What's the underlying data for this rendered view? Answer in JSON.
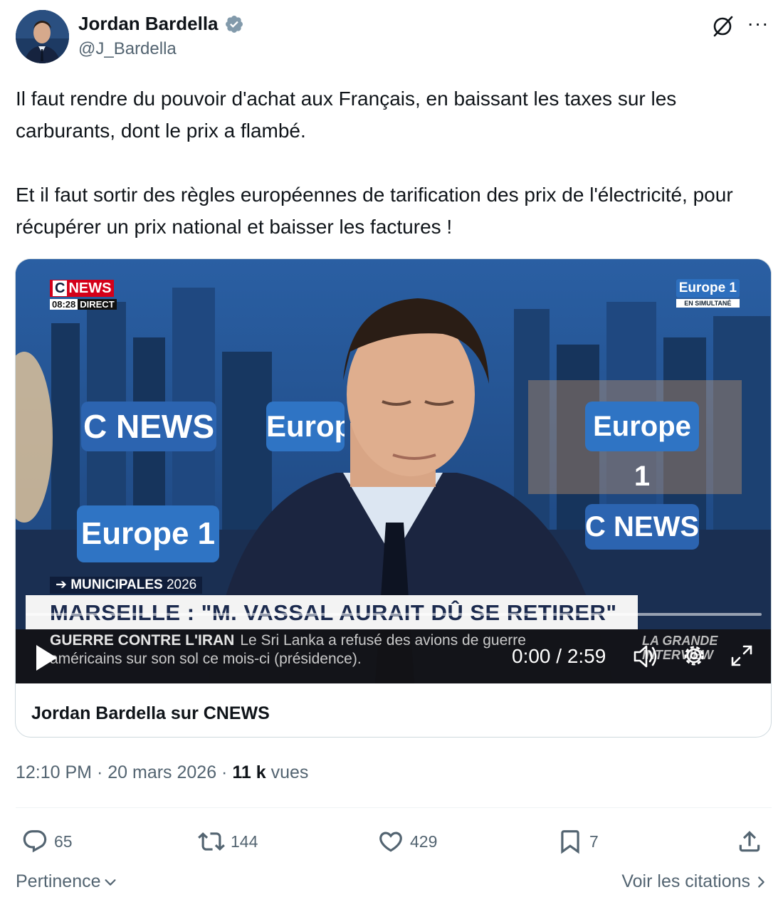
{
  "author": {
    "display_name": "Jordan Bardella",
    "handle": "@J_Bardella",
    "verified_color": "#829aab",
    "avatar_icon": "avatar-photo"
  },
  "header_icons": [
    "grok-icon",
    "more-icon"
  ],
  "more_label": "···",
  "tweet": {
    "paragraph_1": "Il faut rendre du pouvoir d'achat aux Français, en baissant les taxes sur les carburants, dont le prix a flambé.",
    "paragraph_2": "Et il faut sortir des règles européennes de tarification des prix de l'électricité, pour récupérer un prix national et baisser les factures !"
  },
  "video": {
    "channel_logo_c": "C",
    "channel_logo_name": "NEWS",
    "clock_time": "08:28",
    "clock_live": "DIRECT",
    "partner_name": "Europe 1",
    "partner_sub": "EN SIMULTANÉ",
    "studio_logo_cnews": "C NEWS",
    "studio_logo_europe": "Europe 1",
    "kicker": "➔ MUNICIPALES",
    "kicker_year": "2026",
    "headline": "MARSEILLE : \"M. VASSAL AURAIT DÛ SE RETIRER\"",
    "ticker_tag": "GUERRE CONTRE L'IRAN",
    "ticker_text": "Le Sri Lanka a refusé des avions de guerre américains sur son sol ce mois-ci (présidence).",
    "show_name_1": "LA GRANDE",
    "show_name_2": "INTERVIEW",
    "time_readout": "0:00 / 2:59",
    "progress_fraction": 0.0
  },
  "card": {
    "caption": "Jordan Bardella sur CNEWS"
  },
  "meta": {
    "time": "12:10 PM",
    "separator": " · ",
    "date": "20 mars 2026",
    "views_count": "11 k",
    "views_label": "vues"
  },
  "actions": {
    "replies": "65",
    "reposts": "144",
    "likes": "429",
    "bookmarks": "7"
  },
  "footer": {
    "sort_label": "Pertinence",
    "quotes_link": "Voir les citations"
  },
  "colors": {
    "text_primary": "#0f1419",
    "text_secondary": "#536471",
    "border": "#cfd9de",
    "cnews_red": "#d40019",
    "europe1_blue": "#2d6fbe"
  }
}
